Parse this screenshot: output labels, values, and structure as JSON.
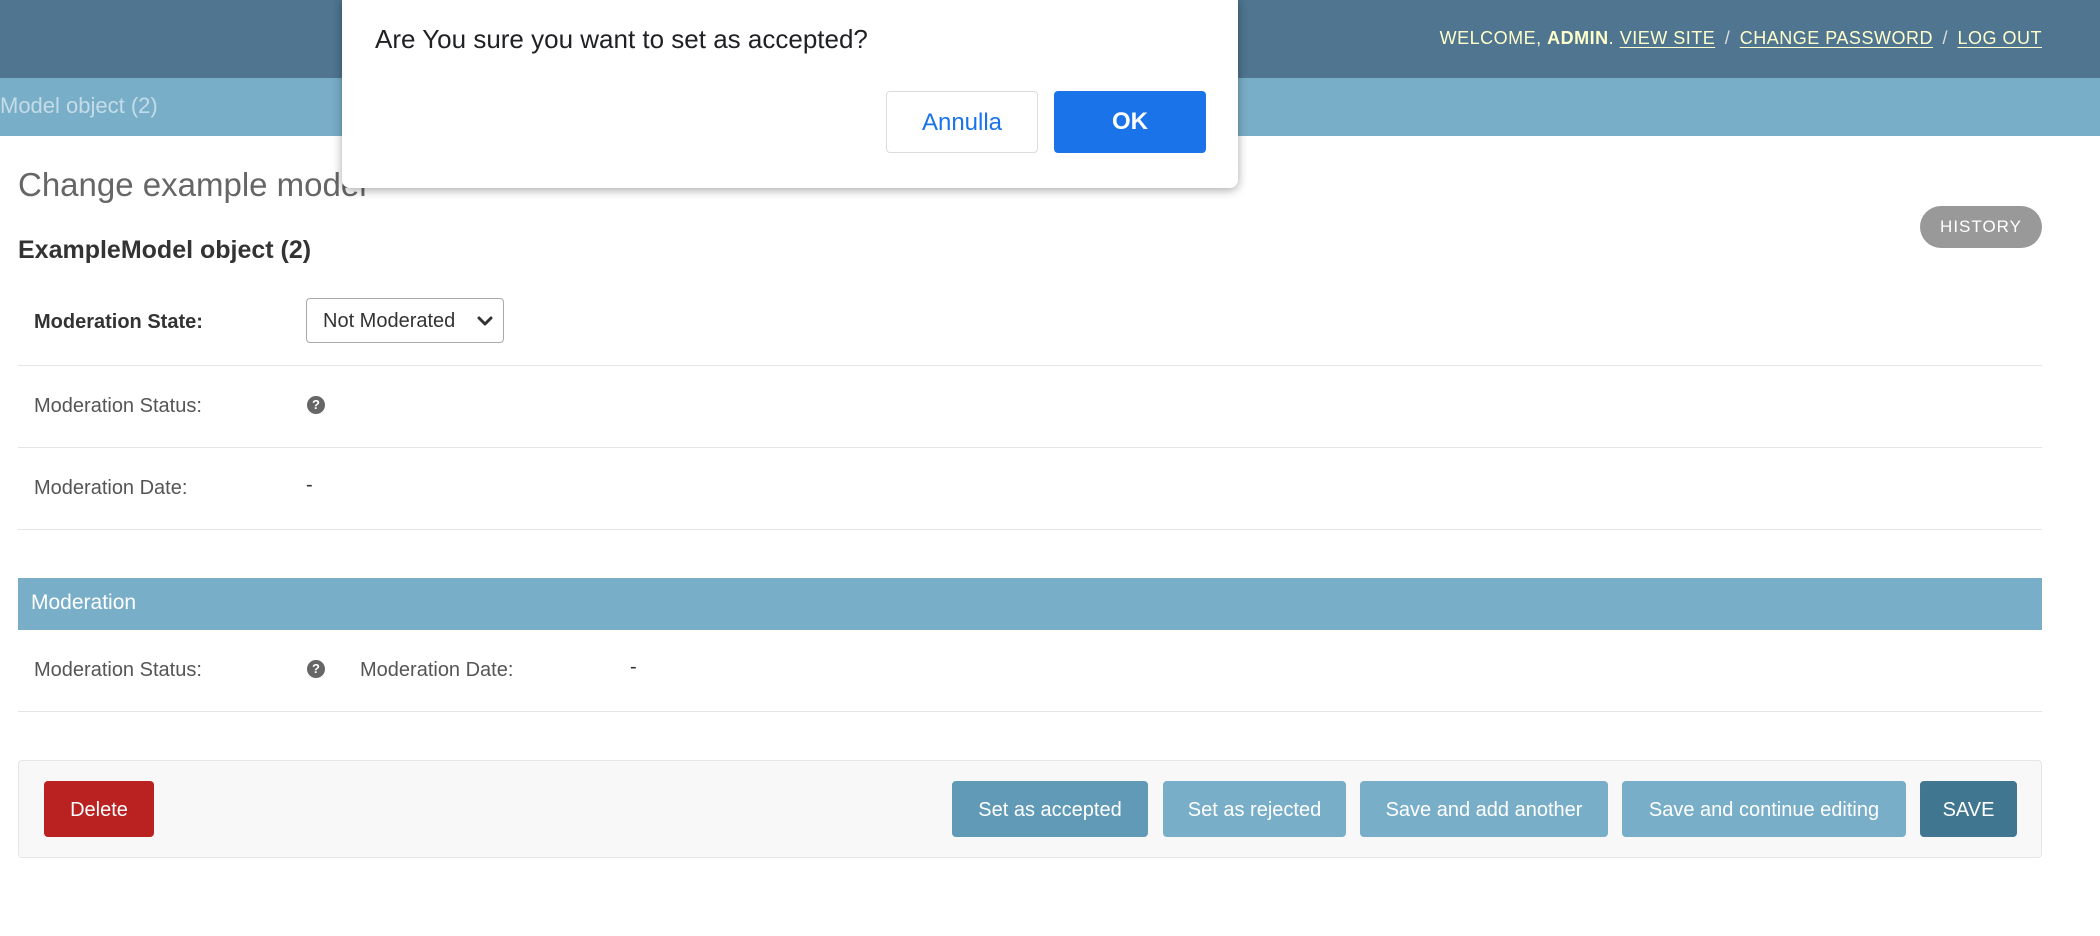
{
  "header": {
    "welcome_label": "Welcome,",
    "username": "admin",
    "view_site": "View site",
    "change_password": "Change password",
    "log_out": "Log out",
    "separator": "/"
  },
  "breadcrumbs": {
    "current": "Model object (2)"
  },
  "page": {
    "title": "Change example model",
    "history_label": "History",
    "object_title": "ExampleModel object (2)"
  },
  "form": {
    "moderation_state_label": "Moderation State:",
    "moderation_state_value": "Not Moderated",
    "moderation_status_label": "Moderation Status:",
    "moderation_date_label": "Moderation Date:",
    "moderation_date_value": "-",
    "help_glyph": "?"
  },
  "moderation_module": {
    "caption": "Moderation",
    "status_label": "Moderation Status:",
    "date_label": "Moderation Date:",
    "date_value": "-"
  },
  "submit_row": {
    "delete": "Delete",
    "set_accepted": "Set as accepted",
    "set_rejected": "Set as rejected",
    "save_add_another": "Save and add another",
    "save_continue": "Save and continue editing",
    "save": "SAVE"
  },
  "dialog": {
    "message": "Are You sure you want to set as accepted?",
    "cancel": "Annulla",
    "ok": "OK"
  },
  "colors": {
    "header_bg": "#4f7590",
    "breadcrumbs_bg": "#79aec8",
    "delete_bg": "#ba2121",
    "save_bg": "#417690",
    "dialog_ok_bg": "#1a73e8"
  }
}
